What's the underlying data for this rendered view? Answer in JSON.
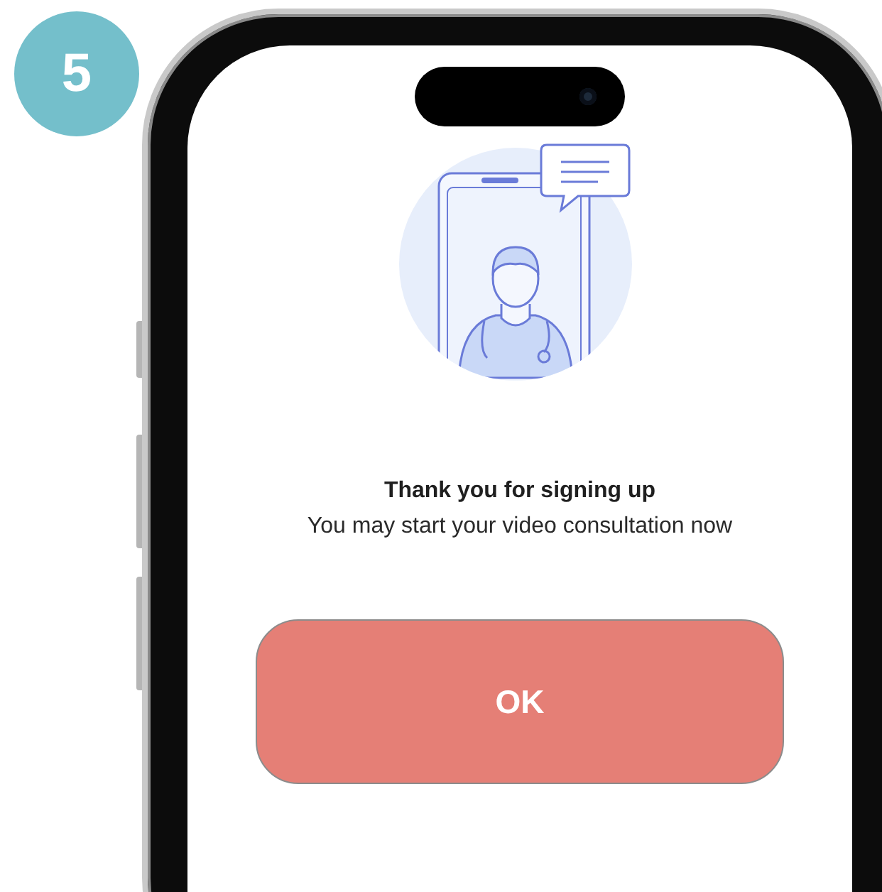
{
  "step_badge": "5",
  "message": {
    "title": "Thank you for signing up",
    "subtitle": "You may start your video consultation now"
  },
  "button": {
    "label": "OK"
  }
}
